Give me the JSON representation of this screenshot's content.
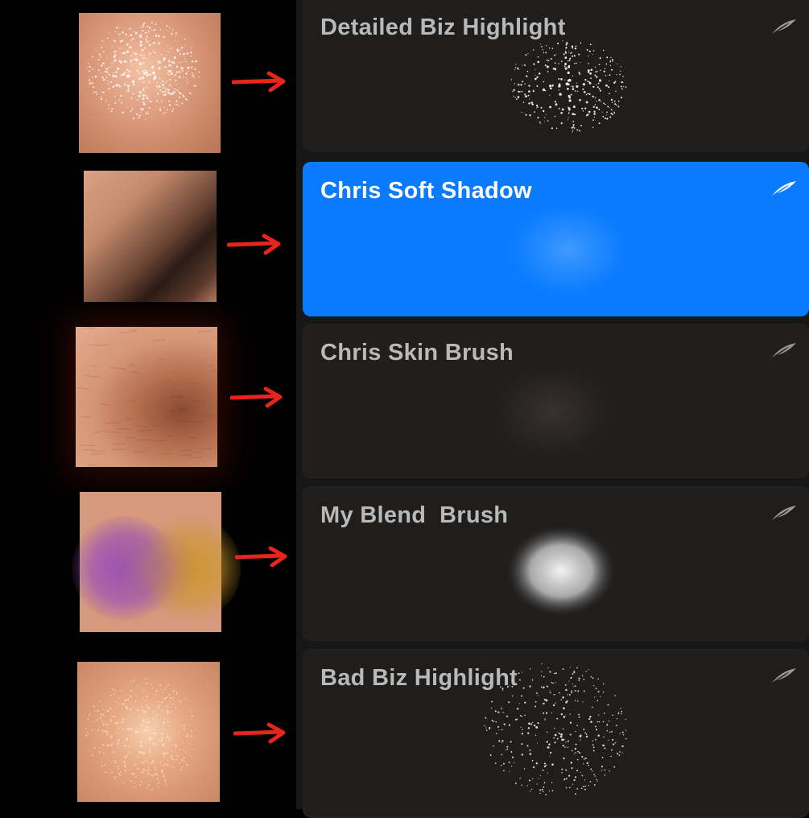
{
  "brushes": [
    {
      "name": "Detailed Biz Highlight",
      "selected": false,
      "icon": "feather-icon",
      "stroke": "sparkle"
    },
    {
      "name": "Chris Soft Shadow",
      "selected": true,
      "icon": "feather-icon",
      "stroke": "soft"
    },
    {
      "name": "Chris Skin Brush",
      "selected": false,
      "icon": "feather-icon",
      "stroke": "texture"
    },
    {
      "name": "My Blend  Brush",
      "selected": false,
      "icon": "feather-icon",
      "stroke": "blend"
    },
    {
      "name": "Bad Biz Highlight",
      "selected": false,
      "icon": "feather-icon",
      "stroke": "speckle"
    }
  ],
  "colors": {
    "selected": "#0a7bff",
    "card": "#1f1e1d",
    "panel": "#171717",
    "arrow": "#e8251a",
    "skin": "#d59474"
  }
}
